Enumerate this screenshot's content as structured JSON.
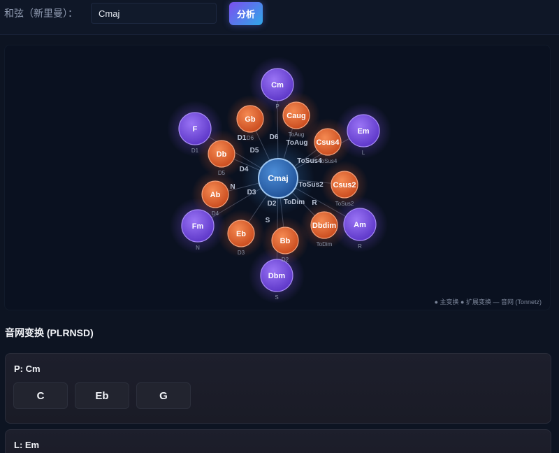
{
  "header": {
    "chord_label": "和弦（新里曼）：",
    "chord_value": "Cmaj",
    "analyze_label": "分析"
  },
  "graph": {
    "center": "Cmaj",
    "nodes": [
      {
        "chord": "Cm",
        "tag": "P",
        "edge": "",
        "kind": "main"
      },
      {
        "chord": "Em",
        "tag": "L",
        "edge": "",
        "kind": "main"
      },
      {
        "chord": "Am",
        "tag": "R",
        "edge": "R",
        "kind": "main"
      },
      {
        "chord": "Dbm",
        "tag": "S",
        "edge": "S",
        "kind": "main"
      },
      {
        "chord": "Fm",
        "tag": "N",
        "edge": "N",
        "kind": "main"
      },
      {
        "chord": "F",
        "tag": "D1",
        "edge": "D1",
        "kind": "main"
      },
      {
        "chord": "Caug",
        "tag": "ToAug",
        "edge": "ToAug",
        "kind": "ext"
      },
      {
        "chord": "Csus4",
        "tag": "ToSus4",
        "edge": "ToSus4",
        "kind": "ext"
      },
      {
        "chord": "Csus2",
        "tag": "ToSus2",
        "edge": "ToSus2",
        "kind": "ext"
      },
      {
        "chord": "Dbdim",
        "tag": "ToDim",
        "edge": "ToDim",
        "kind": "ext"
      },
      {
        "chord": "Bb",
        "tag": "D2",
        "edge": "D2",
        "kind": "ext"
      },
      {
        "chord": "Eb",
        "tag": "D3",
        "edge": "D3",
        "kind": "ext"
      },
      {
        "chord": "Ab",
        "tag": "D4",
        "edge": "D4",
        "kind": "ext"
      },
      {
        "chord": "Db",
        "tag": "D5",
        "edge": "D5",
        "kind": "ext"
      },
      {
        "chord": "Gb",
        "tag": "D6",
        "edge": "D6",
        "kind": "ext"
      }
    ],
    "legend": "● 主变换 ● 扩展变换 — 音网 (Tonnetz)",
    "colors": {
      "main": "#7a4fe0",
      "ext": "#e8632e",
      "center": "#2f6fbf"
    }
  },
  "transforms_section": {
    "title": "音网变换 (PLRNSD)",
    "cards": [
      {
        "title": "P: Cm",
        "notes": [
          "C",
          "Eb",
          "G"
        ]
      },
      {
        "title": "L: Em",
        "notes": []
      }
    ]
  }
}
